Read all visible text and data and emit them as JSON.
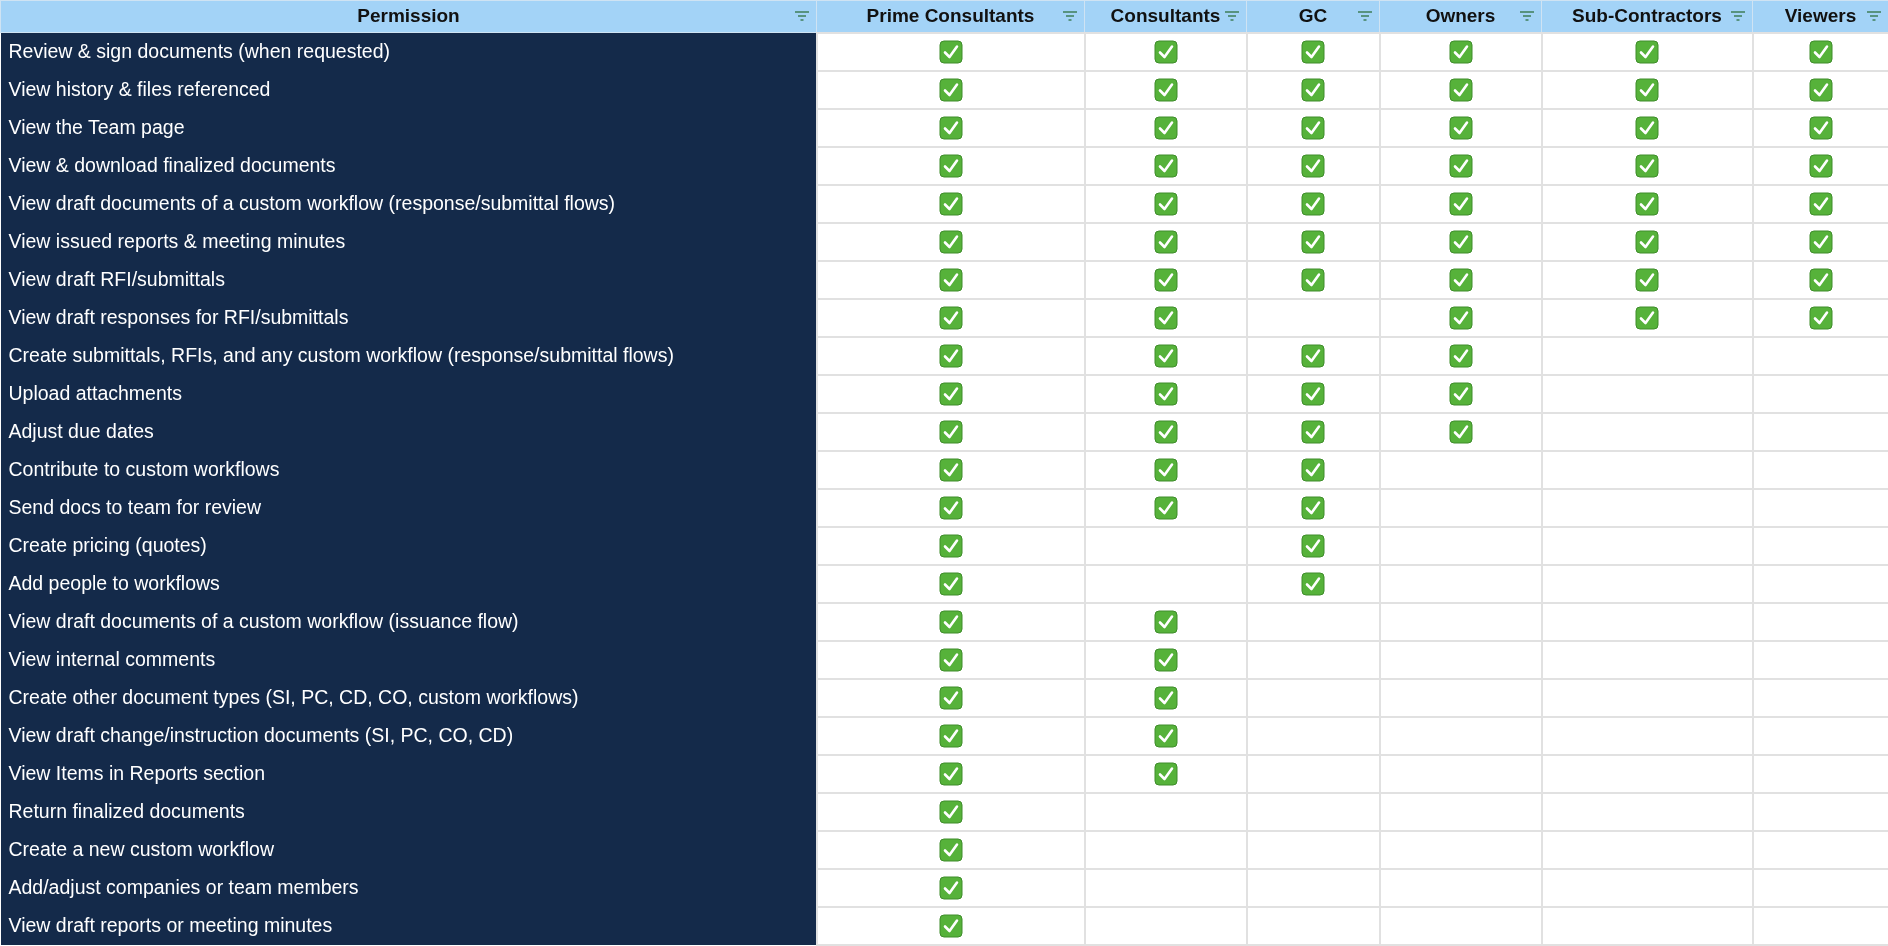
{
  "columns": [
    {
      "label": "Permission"
    },
    {
      "label": "Prime Consultants"
    },
    {
      "label": "Consultants"
    },
    {
      "label": "GC"
    },
    {
      "label": "Owners"
    },
    {
      "label": "Sub-Contractors"
    },
    {
      "label": "Viewers"
    }
  ],
  "rows": [
    {
      "permission": "Review & sign documents (when requested)",
      "checks": [
        true,
        true,
        true,
        true,
        true,
        true
      ]
    },
    {
      "permission": "View history & files referenced",
      "checks": [
        true,
        true,
        true,
        true,
        true,
        true
      ]
    },
    {
      "permission": "View the Team page",
      "checks": [
        true,
        true,
        true,
        true,
        true,
        true
      ]
    },
    {
      "permission": "View  & download finalized documents",
      "checks": [
        true,
        true,
        true,
        true,
        true,
        true
      ]
    },
    {
      "permission": "View draft documents of a custom workflow (response/submittal flows)",
      "checks": [
        true,
        true,
        true,
        true,
        true,
        true
      ]
    },
    {
      "permission": "View issued reports & meeting minutes",
      "checks": [
        true,
        true,
        true,
        true,
        true,
        true
      ]
    },
    {
      "permission": "View draft RFI/submittals",
      "checks": [
        true,
        true,
        true,
        true,
        true,
        true
      ]
    },
    {
      "permission": "View draft responses for RFI/submittals",
      "checks": [
        true,
        true,
        false,
        true,
        true,
        true
      ]
    },
    {
      "permission": "Create submittals, RFIs, and any custom workflow (response/submittal flows)",
      "checks": [
        true,
        true,
        true,
        true,
        false,
        false
      ]
    },
    {
      "permission": "Upload attachments",
      "checks": [
        true,
        true,
        true,
        true,
        false,
        false
      ]
    },
    {
      "permission": "Adjust due dates",
      "checks": [
        true,
        true,
        true,
        true,
        false,
        false
      ]
    },
    {
      "permission": "Contribute to custom workflows",
      "checks": [
        true,
        true,
        true,
        false,
        false,
        false
      ]
    },
    {
      "permission": "Send docs to team for review",
      "checks": [
        true,
        true,
        true,
        false,
        false,
        false
      ]
    },
    {
      "permission": "Create pricing (quotes)",
      "checks": [
        true,
        false,
        true,
        false,
        false,
        false
      ]
    },
    {
      "permission": "Add people to workflows",
      "checks": [
        true,
        false,
        true,
        false,
        false,
        false
      ]
    },
    {
      "permission": "View draft documents of a custom workflow (issuance flow)",
      "checks": [
        true,
        true,
        false,
        false,
        false,
        false
      ]
    },
    {
      "permission": "View internal comments",
      "checks": [
        true,
        true,
        false,
        false,
        false,
        false
      ]
    },
    {
      "permission": "Create other document types (SI, PC, CD, CO, custom workflows)",
      "checks": [
        true,
        true,
        false,
        false,
        false,
        false
      ]
    },
    {
      "permission": "View draft change/instruction documents (SI, PC, CO, CD)",
      "checks": [
        true,
        true,
        false,
        false,
        false,
        false
      ]
    },
    {
      "permission": "View Items in Reports section",
      "checks": [
        true,
        true,
        false,
        false,
        false,
        false
      ]
    },
    {
      "permission": "Return finalized documents",
      "checks": [
        true,
        false,
        false,
        false,
        false,
        false
      ]
    },
    {
      "permission": "Create a new custom workflow",
      "checks": [
        true,
        false,
        false,
        false,
        false,
        false
      ]
    },
    {
      "permission": "Add/adjust companies or team members",
      "checks": [
        true,
        false,
        false,
        false,
        false,
        false
      ]
    },
    {
      "permission": "View draft reports or meeting minutes",
      "checks": [
        true,
        false,
        false,
        false,
        false,
        false
      ]
    }
  ]
}
